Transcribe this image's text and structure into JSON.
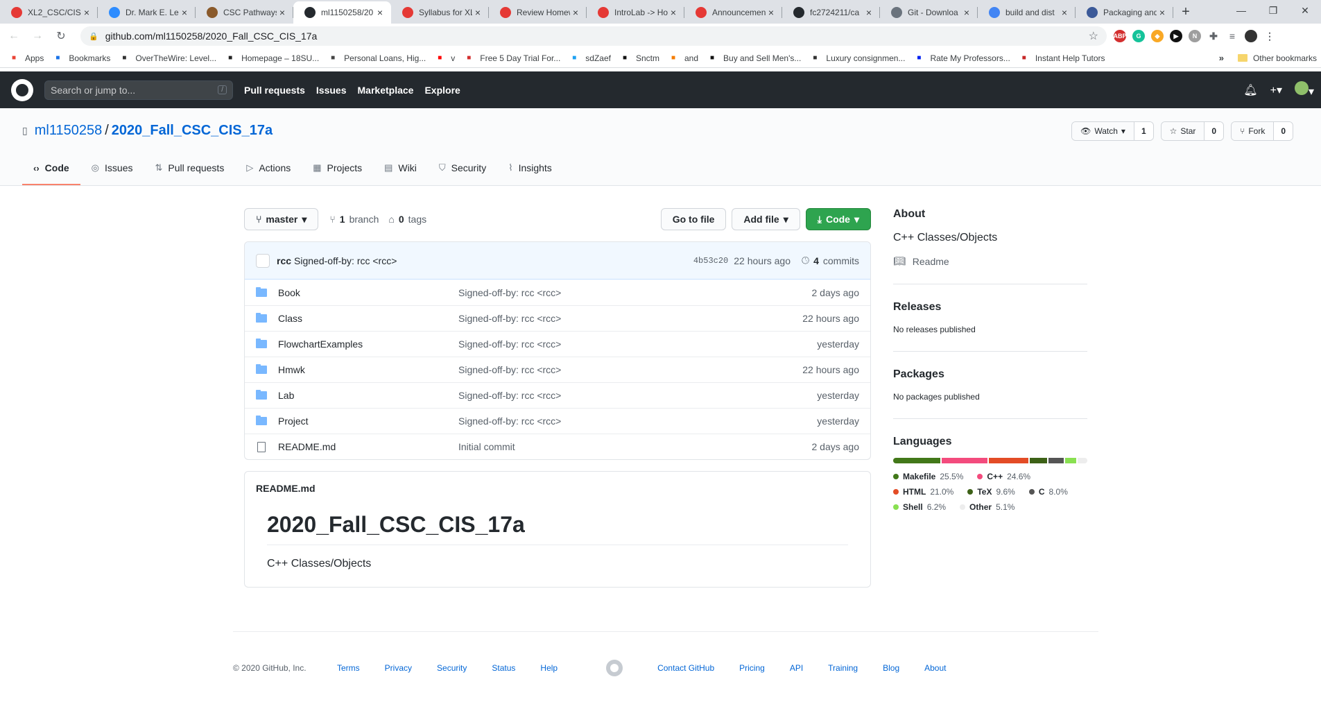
{
  "browser": {
    "tabs": [
      {
        "title": "XL2_CSC/CIS-",
        "color": "#e53935"
      },
      {
        "title": "Dr. Mark E. Le",
        "color": "#2d8cff"
      },
      {
        "title": "CSC Pathways",
        "color": "#8a5a2b"
      },
      {
        "title": "ml1150258/20",
        "color": "#24292e",
        "active": true
      },
      {
        "title": "Syllabus for XL",
        "color": "#e53935"
      },
      {
        "title": "Review Homew",
        "color": "#e53935"
      },
      {
        "title": "IntroLab -> Ho",
        "color": "#e53935"
      },
      {
        "title": "Announcemen",
        "color": "#e53935"
      },
      {
        "title": "fc2724211/ca",
        "color": "#24292e"
      },
      {
        "title": "Git - Downloa",
        "color": "#6a737d"
      },
      {
        "title": "build and dist",
        "color": "#4285f4"
      },
      {
        "title": "Packaging and",
        "color": "#3b5998"
      }
    ],
    "url": "github.com/ml1150258/2020_Fall_CSC_CIS_17a",
    "bookmarks": [
      {
        "label": "Apps",
        "color": "#ea4335"
      },
      {
        "label": "Bookmarks",
        "color": "#1a73e8"
      },
      {
        "label": "OverTheWire: Level...",
        "color": "#333"
      },
      {
        "label": "Homepage – 18SU...",
        "color": "#222"
      },
      {
        "label": "Personal Loans, Hig...",
        "color": "#444"
      },
      {
        "label": "v",
        "color": "#ff0000"
      },
      {
        "label": "Free 5 Day Trial For...",
        "color": "#d32f2f"
      },
      {
        "label": "sdZaef",
        "color": "#1da1f2"
      },
      {
        "label": "Snctm",
        "color": "#111"
      },
      {
        "label": "and",
        "color": "#f57c00"
      },
      {
        "label": "Buy and Sell Men's...",
        "color": "#111"
      },
      {
        "label": "Luxury consignmen...",
        "color": "#333"
      },
      {
        "label": "Rate My Professors...",
        "color": "#0021f3"
      },
      {
        "label": "Instant Help Tutors",
        "color": "#c62828"
      }
    ],
    "bookmarks_more": "»",
    "other_bookmarks": "Other bookmarks"
  },
  "github": {
    "search_placeholder": "Search or jump to...",
    "search_key": "/",
    "nav": [
      "Pull requests",
      "Issues",
      "Marketplace",
      "Explore"
    ]
  },
  "repo": {
    "owner": "ml1150258",
    "name": "2020_Fall_CSC_CIS_17a",
    "watch_label": "Watch",
    "watch_count": "1",
    "star_label": "Star",
    "star_count": "0",
    "fork_label": "Fork",
    "fork_count": "0",
    "tabs": [
      "Code",
      "Issues",
      "Pull requests",
      "Actions",
      "Projects",
      "Wiki",
      "Security",
      "Insights"
    ],
    "branch": "master",
    "branch_count": "1",
    "branch_label": "branch",
    "tag_count": "0",
    "tag_label": "tags",
    "go_to_file": "Go to file",
    "add_file": "Add file",
    "code_button": "Code",
    "commit": {
      "author": "rcc",
      "message": "Signed-off-by: rcc <rcc>",
      "sha": "4b53c20",
      "time": "22 hours ago",
      "count": "4",
      "count_label": "commits"
    },
    "files": [
      {
        "name": "Book",
        "type": "dir",
        "message": "Signed-off-by: rcc <rcc>",
        "time": "2 days ago"
      },
      {
        "name": "Class",
        "type": "dir",
        "message": "Signed-off-by: rcc <rcc>",
        "time": "22 hours ago"
      },
      {
        "name": "FlowchartExamples",
        "type": "dir",
        "message": "Signed-off-by: rcc <rcc>",
        "time": "yesterday"
      },
      {
        "name": "Hmwk",
        "type": "dir",
        "message": "Signed-off-by: rcc <rcc>",
        "time": "22 hours ago"
      },
      {
        "name": "Lab",
        "type": "dir",
        "message": "Signed-off-by: rcc <rcc>",
        "time": "yesterday"
      },
      {
        "name": "Project",
        "type": "dir",
        "message": "Signed-off-by: rcc <rcc>",
        "time": "yesterday"
      },
      {
        "name": "README.md",
        "type": "file",
        "message": "Initial commit",
        "time": "2 days ago"
      }
    ],
    "readme": {
      "filename": "README.md",
      "heading": "2020_Fall_CSC_CIS_17a",
      "body": "C++ Classes/Objects"
    }
  },
  "sidebar": {
    "about_title": "About",
    "about_desc": "C++ Classes/Objects",
    "readme_link": "Readme",
    "releases_title": "Releases",
    "releases_text": "No releases published",
    "packages_title": "Packages",
    "packages_text": "No packages published",
    "languages_title": "Languages",
    "languages": [
      {
        "name": "Makefile",
        "percent": "25.5%",
        "value": 25.5,
        "color": "#427819"
      },
      {
        "name": "C++",
        "percent": "24.6%",
        "value": 24.6,
        "color": "#f34b7d"
      },
      {
        "name": "HTML",
        "percent": "21.0%",
        "value": 21.0,
        "color": "#e34c26"
      },
      {
        "name": "TeX",
        "percent": "9.6%",
        "value": 9.6,
        "color": "#3d6117"
      },
      {
        "name": "C",
        "percent": "8.0%",
        "value": 8.0,
        "color": "#555555"
      },
      {
        "name": "Shell",
        "percent": "6.2%",
        "value": 6.2,
        "color": "#89e051"
      },
      {
        "name": "Other",
        "percent": "5.1%",
        "value": 5.1,
        "color": "#ededed"
      }
    ]
  },
  "footer": {
    "copyright": "© 2020 GitHub, Inc.",
    "left_links": [
      "Terms",
      "Privacy",
      "Security",
      "Status",
      "Help"
    ],
    "right_links": [
      "Contact GitHub",
      "Pricing",
      "API",
      "Training",
      "Blog",
      "About"
    ]
  }
}
